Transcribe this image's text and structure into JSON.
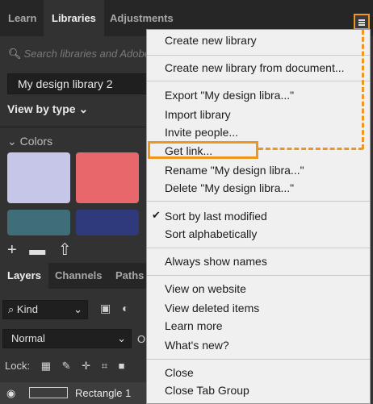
{
  "tabs": [
    "Learn",
    "Libraries",
    "Adjustments"
  ],
  "libraries": {
    "search_placeholder": "Search libraries and Adobe",
    "current_library": "My design library 2",
    "view_by": "View by type",
    "colors_header": "Colors",
    "swatches": [
      "#c5c6e8",
      "#e8676b",
      "#3f6e78",
      "#2e3a7c"
    ]
  },
  "layers_tabs": [
    "Layers",
    "Channels",
    "Paths"
  ],
  "layers": {
    "kind": "Kind",
    "blend_mode": "Normal",
    "opacity_label": "O",
    "lock_label": "Lock:",
    "layer_name": "Rectangle 1"
  },
  "menu": {
    "create_new": "Create new library",
    "create_from_doc": "Create new library from document...",
    "export": "Export \"My design libra...\"",
    "import": "Import library",
    "invite": "Invite people...",
    "get_link": "Get link...",
    "rename": "Rename \"My design libra...\"",
    "delete": "Delete \"My design libra...\"",
    "sort_modified": "Sort by last modified",
    "sort_alpha": "Sort alphabetically",
    "always_show": "Always show names",
    "view_website": "View on website",
    "view_deleted": "View deleted items",
    "learn_more": "Learn more",
    "whats_new": "What's new?",
    "close": "Close",
    "close_group": "Close Tab Group"
  },
  "colors": {
    "highlight": "#f0961e",
    "menu_bg": "#f0f0f0",
    "panel_bg": "#323232"
  }
}
